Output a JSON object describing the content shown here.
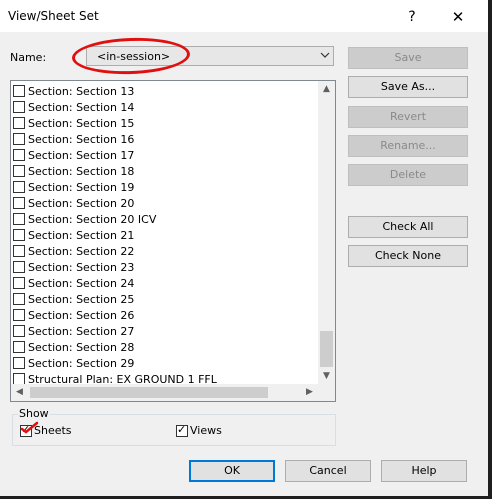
{
  "window": {
    "title": "View/Sheet Set",
    "help_glyph": "?",
    "close_glyph": "✕"
  },
  "name": {
    "label": "Name:",
    "value": "<in-session>"
  },
  "list": {
    "items": [
      "Section: Section 13",
      "Section: Section 14",
      "Section: Section 15",
      "Section: Section 16",
      "Section: Section 17",
      "Section: Section 18",
      "Section: Section 19",
      "Section: Section 20",
      "Section: Section 20 ICV",
      "Section: Section 21",
      "Section: Section 22",
      "Section: Section 23",
      "Section: Section 24",
      "Section: Section 25",
      "Section: Section 26",
      "Section: Section 27",
      "Section: Section 28",
      "Section: Section 29",
      "Structural Plan: EX GROUND 1 FFL"
    ]
  },
  "side_buttons": {
    "save": "Save",
    "save_as": "Save As...",
    "revert": "Revert",
    "rename": "Rename...",
    "delete": "Delete",
    "check_all": "Check All",
    "check_none": "Check None"
  },
  "show": {
    "legend": "Show",
    "sheets": "Sheets",
    "views": "Views",
    "sheets_checked": true,
    "views_checked": true
  },
  "bottom_buttons": {
    "ok": "OK",
    "cancel": "Cancel",
    "help": "Help"
  },
  "annotation_color": "#e01010"
}
